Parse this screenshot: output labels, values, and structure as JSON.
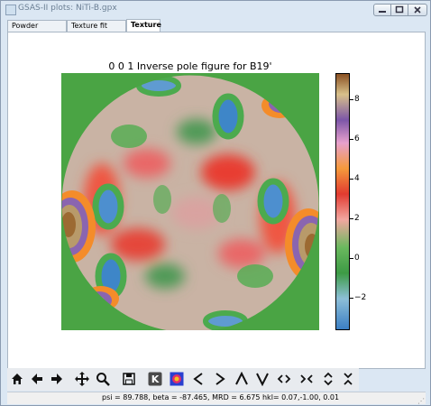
{
  "window": {
    "title": "GSAS-II plots: NiTi-B.gpx"
  },
  "tabs": [
    {
      "label": "Powder Patterns"
    },
    {
      "label": "Texture fit error"
    },
    {
      "label": "Texture"
    }
  ],
  "plot": {
    "title": "0 0 1 Inverse pole figure for B19'",
    "colorbar_ticks": [
      "8",
      "6",
      "4",
      "2",
      "0",
      "−2"
    ],
    "colormap": "colored gradient (blue-green-red-orange-purple-brown)"
  },
  "toolbar": {
    "buttons": [
      {
        "icon": "home-icon",
        "glyph": "⌂"
      },
      {
        "icon": "back-arrow-icon",
        "glyph": "←"
      },
      {
        "icon": "forward-arrow-icon",
        "glyph": "→"
      },
      {
        "icon": "pan-icon",
        "glyph": "✚"
      },
      {
        "icon": "zoom-icon",
        "glyph": "⌕"
      },
      {
        "icon": "save-icon",
        "glyph": "▣"
      },
      {
        "icon": "k-key-icon",
        "glyph": "K"
      },
      {
        "icon": "colormap-icon",
        "glyph": ""
      },
      {
        "icon": "less-than-icon",
        "glyph": "<"
      },
      {
        "icon": "greater-than-icon",
        "glyph": ">"
      },
      {
        "icon": "caret-up-icon",
        "glyph": "Λ"
      },
      {
        "icon": "caret-down-icon",
        "glyph": "V"
      },
      {
        "icon": "expand-horizontal-icon",
        "glyph": "<>"
      },
      {
        "icon": "contract-horizontal-icon",
        "glyph": "><"
      },
      {
        "icon": "expand-vertical-icon",
        "glyph": "∧∨"
      },
      {
        "icon": "contract-vertical-icon",
        "glyph": "∨∧"
      }
    ]
  },
  "status": {
    "text": "psi =   89.788, beta =  -87.465, MRD =    6.675 hkl= 0.07,-1.00, 0.01"
  },
  "colors": {
    "background_green": "#4aa444",
    "window_frame": "#dbe7f3"
  }
}
